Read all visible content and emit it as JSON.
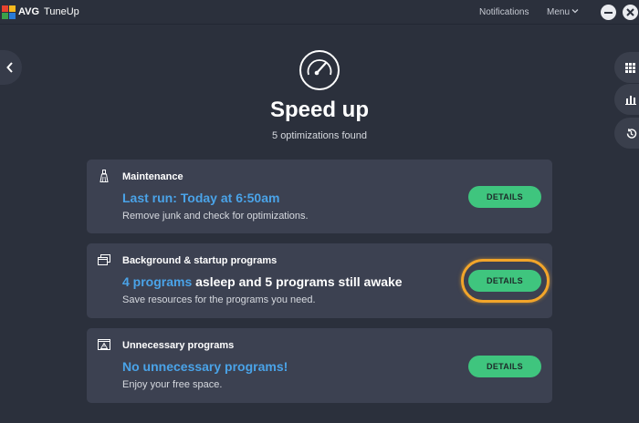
{
  "app": {
    "brand": "AVG",
    "product": "TuneUp",
    "notifications_label": "Notifications",
    "menu_label": "Menu"
  },
  "page": {
    "title": "Speed up",
    "subtitle": "5 optimizations found"
  },
  "cards": [
    {
      "title": "Maintenance",
      "status_highlight": "Last run: Today at 6:50am",
      "status_rest": "",
      "description": "Remove junk and check for optimizations.",
      "button": "DETAILS",
      "icon": "broom-icon"
    },
    {
      "title": "Background & startup programs",
      "status_highlight": "4 programs",
      "status_rest": " asleep and 5 programs still awake",
      "description": "Save resources for the programs you need.",
      "button": "DETAILS",
      "icon": "windows-stack-icon",
      "highlighted": true
    },
    {
      "title": "Unnecessary programs",
      "status_highlight": "No unnecessary programs!",
      "status_rest": "",
      "description": "Enjoy your free space.",
      "button": "DETAILS",
      "icon": "window-warning-icon"
    }
  ],
  "colors": {
    "background": "#2b303c",
    "card": "#3c4151",
    "accent_blue": "#4aa3e8",
    "button_green": "#3fc57e",
    "highlight_orange": "#f2a52a"
  }
}
